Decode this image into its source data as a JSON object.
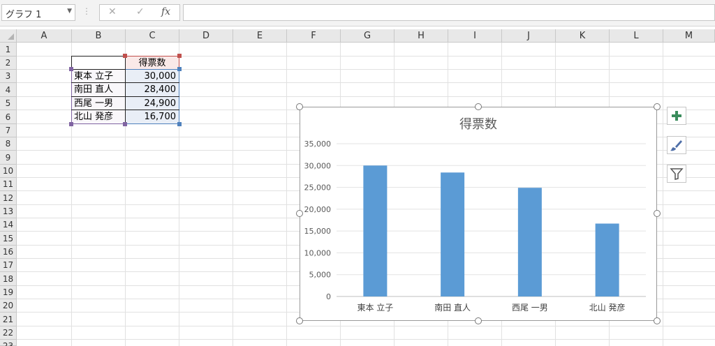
{
  "formula_bar": {
    "name_box": "グラフ 1",
    "cancel_glyph": "✕",
    "enter_glyph": "✓",
    "function_label": "fx",
    "formula": ""
  },
  "columns": [
    "A",
    "B",
    "C",
    "D",
    "E",
    "F",
    "G",
    "H",
    "I",
    "J",
    "K",
    "L",
    "M"
  ],
  "rows": [
    "1",
    "2",
    "3",
    "4",
    "5",
    "6",
    "7",
    "8",
    "9",
    "10",
    "11",
    "12",
    "13",
    "14",
    "15",
    "16",
    "17",
    "18",
    "19",
    "20",
    "21",
    "22",
    "23"
  ],
  "cells": {
    "C2": "得票数",
    "B3": "東本 立子",
    "C3": "30,000",
    "B4": "南田 直人",
    "C4": "28,400",
    "B5": "西尾 一男",
    "C5": "24,900",
    "B6": "北山 発彦",
    "C6": "16,700"
  },
  "chart_side_buttons": {
    "elements": "chart-elements-plus-icon",
    "styles": "brush-icon",
    "filters": "filter-icon"
  },
  "colors": {
    "bar": "#5b9bd5",
    "selection_border": "#c0504d"
  },
  "chart_data": {
    "type": "bar",
    "title": "得票数",
    "categories": [
      "東本 立子",
      "南田 直人",
      "西尾 一男",
      "北山 発彦"
    ],
    "values": [
      30000,
      28400,
      24900,
      16700
    ],
    "ylim": [
      0,
      35000
    ],
    "yticks": [
      "0",
      "5,000",
      "10,000",
      "15,000",
      "20,000",
      "25,000",
      "30,000",
      "35,000"
    ],
    "grid": true,
    "legend": "none"
  }
}
